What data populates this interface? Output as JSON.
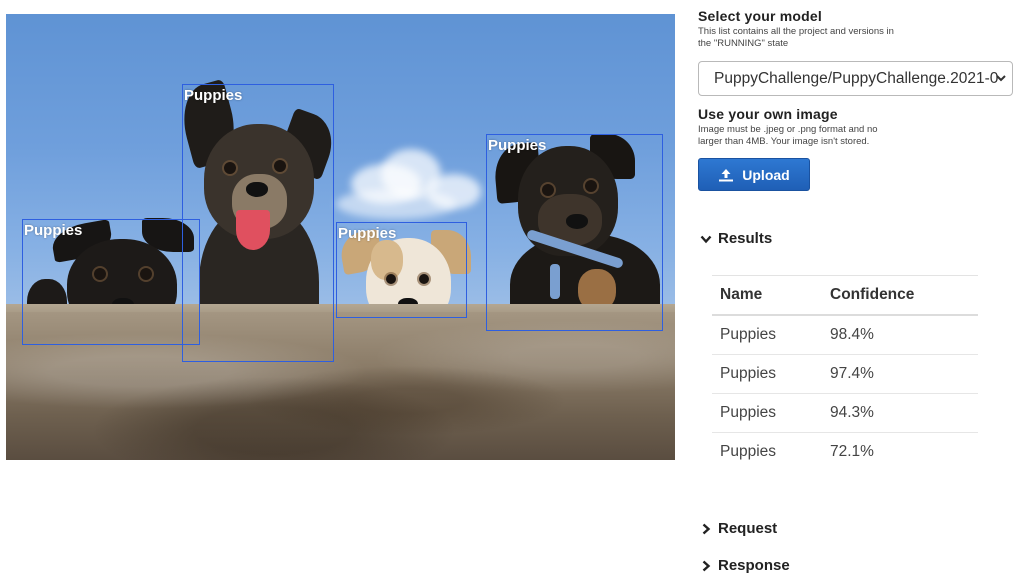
{
  "image": {
    "detections": [
      {
        "label": "Puppies"
      },
      {
        "label": "Puppies"
      },
      {
        "label": "Puppies"
      },
      {
        "label": "Puppies"
      }
    ]
  },
  "model": {
    "title": "Select your model",
    "subtitle": "This list contains all the project and versions in the \"RUNNING\" state",
    "selected": "PuppyChallenge/PuppyChallenge.2021-0"
  },
  "own_image": {
    "title": "Use your own image",
    "subtitle": "Image must be .jpeg or .png format and no larger than 4MB. Your image isn't stored.",
    "upload_label": "Upload"
  },
  "results": {
    "title": "Results",
    "columns": [
      "Name",
      "Confidence"
    ],
    "rows": [
      {
        "name": "Puppies",
        "confidence": "98.4%"
      },
      {
        "name": "Puppies",
        "confidence": "97.4%"
      },
      {
        "name": "Puppies",
        "confidence": "94.3%"
      },
      {
        "name": "Puppies",
        "confidence": "72.1%"
      }
    ]
  },
  "request": {
    "title": "Request"
  },
  "response": {
    "title": "Response"
  },
  "colors": {
    "bbox": "#2e5fe0",
    "button": "#1f5fb6"
  },
  "icons": [
    "upload-icon",
    "chevron-down-icon",
    "chevron-right-icon",
    "select-chevron-icon"
  ]
}
